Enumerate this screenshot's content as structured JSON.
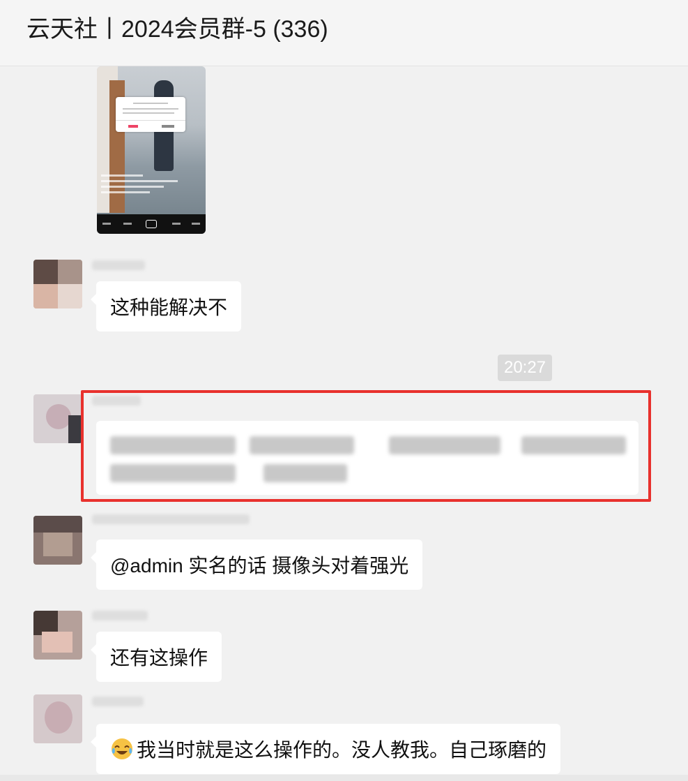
{
  "header": {
    "title": "云天社丨2024会员群-5 (336)"
  },
  "messages": [
    {
      "text": "这种能解决不"
    },
    {
      "time": "20:27"
    },
    {
      "text": "@admin 实名的话 摄像头对着强光"
    },
    {
      "text": "还有这操作"
    },
    {
      "text": "我当时就是这么操作的。没人教我。自己琢磨的"
    }
  ],
  "icons": {
    "laugh_emoji": "face-with-tears-of-joy-icon"
  }
}
